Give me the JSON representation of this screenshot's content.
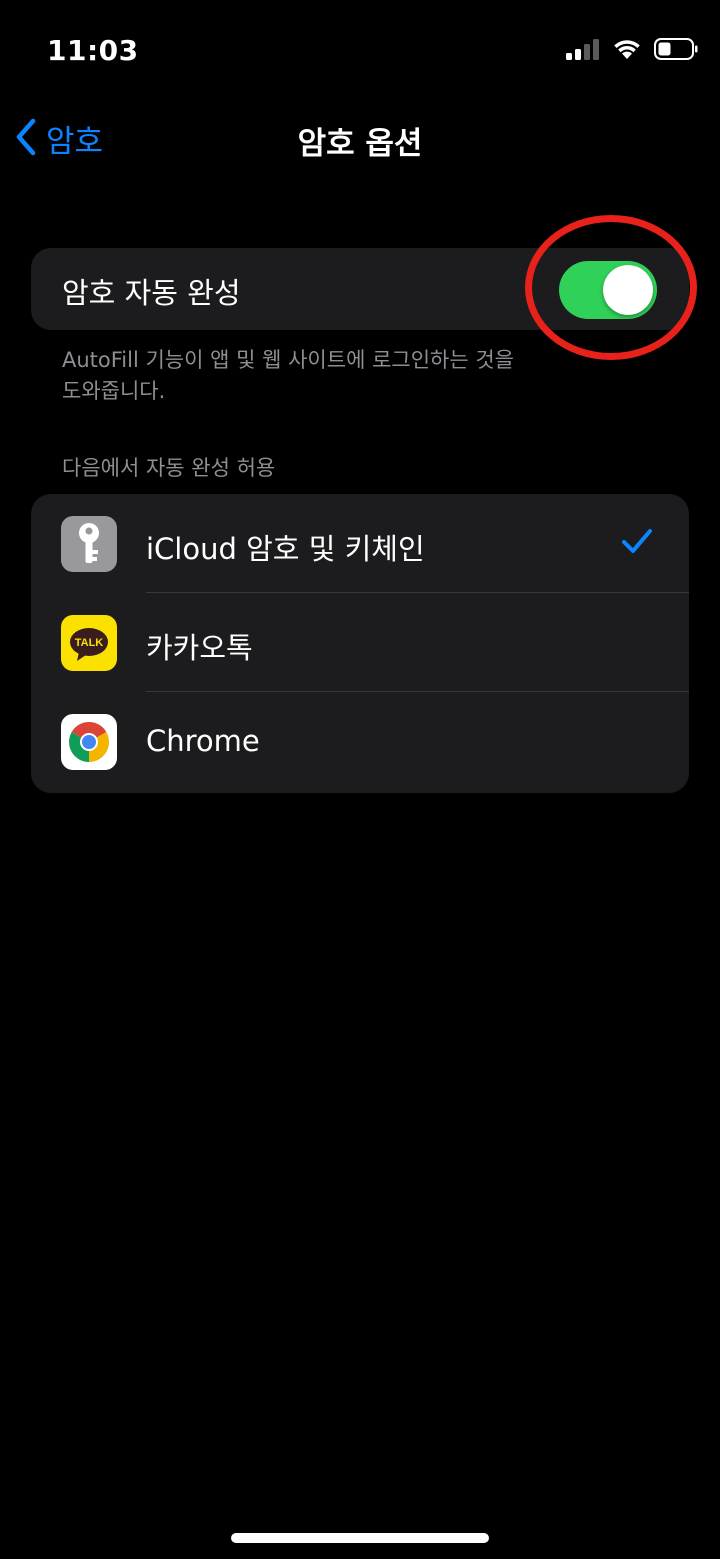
{
  "status_bar": {
    "time": "11:03",
    "icons": [
      "cellular-signal-icon",
      "wifi-icon",
      "battery-icon"
    ]
  },
  "nav": {
    "back_label": "암호",
    "title": "암호 옵션",
    "accent_color": "#0a84ff"
  },
  "autofill": {
    "label": "암호 자동 완성",
    "toggle_on": true,
    "toggle_color": "#30d158",
    "description": "AutoFill 기능이 앱 및 웹 사이트에 로그인하는 것을 도와줍니다."
  },
  "annotation": {
    "highlight_color": "#e8211b"
  },
  "providers": {
    "header": "다음에서 자동 완성 허용",
    "items": [
      {
        "label": "iCloud 암호 및 키체인",
        "icon": "keychain-key-icon",
        "selected": true
      },
      {
        "label": "카카오톡",
        "icon": "kakaotalk-icon",
        "icon_text": "TALK",
        "selected": false
      },
      {
        "label": "Chrome",
        "icon": "chrome-icon",
        "selected": false
      }
    ]
  }
}
